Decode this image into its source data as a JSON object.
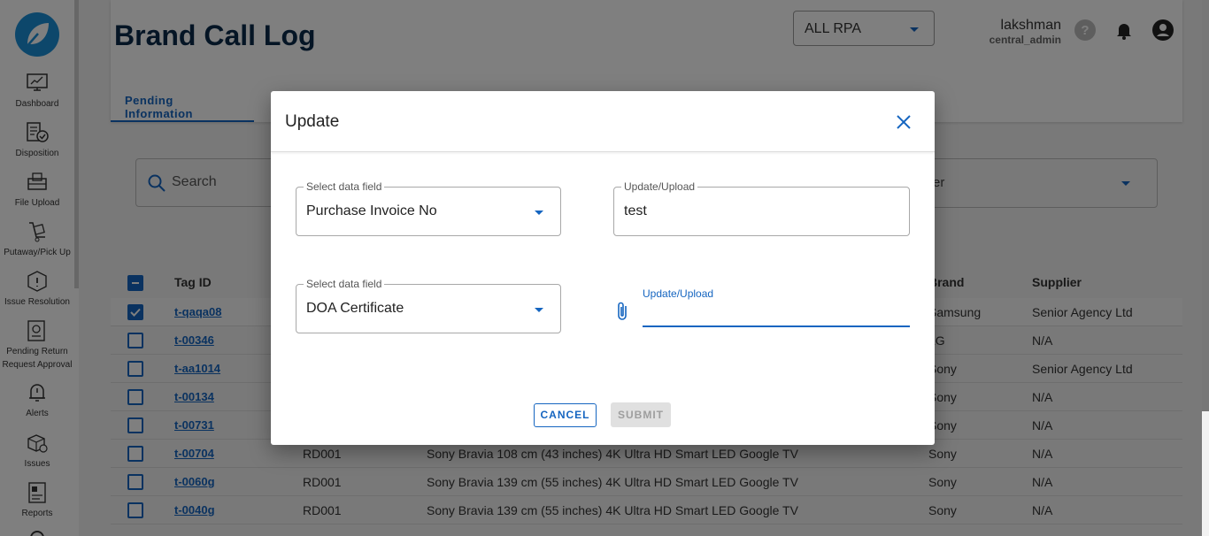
{
  "sidebar": {
    "logo": "leaf-logo",
    "items": [
      {
        "label": "Dashboard",
        "icon": "dashboard-icon"
      },
      {
        "label": "Disposition",
        "icon": "disposition-icon"
      },
      {
        "label": "File Upload",
        "icon": "file-upload-icon"
      },
      {
        "label": "Putaway/Pick Up",
        "icon": "putaway-icon"
      },
      {
        "label": "Issue Resolution",
        "icon": "issue-resolution-icon"
      },
      {
        "label": "Pending Return Request Approval",
        "icon": "pending-return-icon"
      },
      {
        "label": "Alerts",
        "icon": "alerts-icon"
      },
      {
        "label": "Issues",
        "icon": "issues-icon"
      },
      {
        "label": "Reports",
        "icon": "reports-icon"
      }
    ]
  },
  "header": {
    "title": "Brand Call Log",
    "rpa_select": "ALL RPA",
    "user_name": "lakshman",
    "user_role": "central_admin"
  },
  "tabs": [
    {
      "label": "Pending Information"
    }
  ],
  "filters": {
    "search_placeholder": "Search",
    "filter_partial": "er"
  },
  "table": {
    "headers": {
      "tag_id": "Tag ID",
      "brand": "Brand",
      "supplier": "Supplier"
    },
    "rows": [
      {
        "tag": "t-qaqa08",
        "rd": "",
        "product": "",
        "brand": "Samsung",
        "supplier": "Senior Agency Ltd",
        "checked": true
      },
      {
        "tag": "t-00346",
        "rd": "",
        "product": "",
        "brand": "LG",
        "supplier": "N/A",
        "checked": false
      },
      {
        "tag": "t-aa1014",
        "rd": "",
        "product": "",
        "brand": "Sony",
        "supplier": "Senior Agency Ltd",
        "checked": false
      },
      {
        "tag": "t-00134",
        "rd": "",
        "product": "",
        "brand": "Sony",
        "supplier": "N/A",
        "checked": false
      },
      {
        "tag": "t-00731",
        "rd": "",
        "product": "",
        "brand": "Sony",
        "supplier": "N/A",
        "checked": false
      },
      {
        "tag": "t-00704",
        "rd": "RD001",
        "product": "Sony Bravia 108 cm (43 inches) 4K Ultra HD Smart LED Google TV",
        "brand": "Sony",
        "supplier": "N/A",
        "checked": false
      },
      {
        "tag": "t-0060g",
        "rd": "RD001",
        "product": "Sony Bravia 139 cm (55 inches) 4K Ultra HD Smart LED Google TV",
        "brand": "Sony",
        "supplier": "N/A",
        "checked": false
      },
      {
        "tag": "t-0040g",
        "rd": "RD001",
        "product": "Sony Bravia 139 cm (55 inches) 4K Ultra HD Smart LED Google TV",
        "brand": "Sony",
        "supplier": "N/A",
        "checked": false
      }
    ]
  },
  "dialog": {
    "title": "Update",
    "field1": {
      "legend": "Select data field",
      "value": "Purchase Invoice No"
    },
    "upload1": {
      "legend": "Update/Upload",
      "value": "test"
    },
    "field2": {
      "legend": "Select data field",
      "value": "DOA Certificate"
    },
    "upload2": {
      "label": "Update/Upload",
      "value": ""
    },
    "cancel_label": "CANCEL",
    "submit_label": "SUBMIT"
  },
  "colors": {
    "accent": "#1565c0",
    "title": "#0a2a4a",
    "logo": "#1b8fd6"
  }
}
